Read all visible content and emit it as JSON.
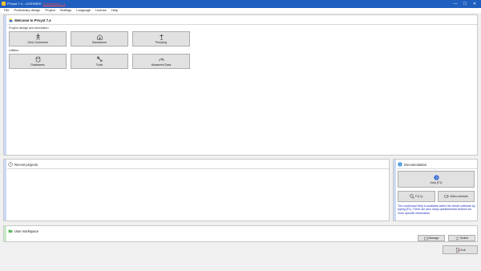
{
  "window": {
    "title": "PVsyst 7.4 - LICENSED",
    "license_tag": "(Licensed to ...)",
    "minimize_glyph": "—",
    "maximize_glyph": "☐",
    "close_glyph": "✕"
  },
  "menu": [
    "File",
    "Preliminary design",
    "Project",
    "Settings",
    "Language",
    "License",
    "Help"
  ],
  "welcome": {
    "title": "Welcome to PVsyst 7.4",
    "project_section": "Project design and simulation",
    "project_buttons": [
      "Grid-Connected",
      "Standalone",
      "Pumping"
    ],
    "utilities_section": "Utilities",
    "utility_buttons": [
      "Databases",
      "Tools",
      "Measured Data"
    ]
  },
  "recent": {
    "title": "Recent projects"
  },
  "documentation": {
    "title": "Documentation",
    "help_label": "Help (F1)",
    "faq_label": "F.A.Q.",
    "videos_label": "Video tutorials",
    "note": "The contextual Help is available within the whole software by typing [F1]. There are also many questionmark buttons for more specific information."
  },
  "workspace": {
    "title": "User workspace",
    "manage_label": "Manage",
    "switch_label": "Switch"
  },
  "exit_label": "Exit",
  "colors": {
    "titlebar": "#1f5fbf",
    "accent_blue": "#cbdaf5",
    "accent_green": "#c8eac8",
    "doc_text": "#1a2fb8"
  }
}
